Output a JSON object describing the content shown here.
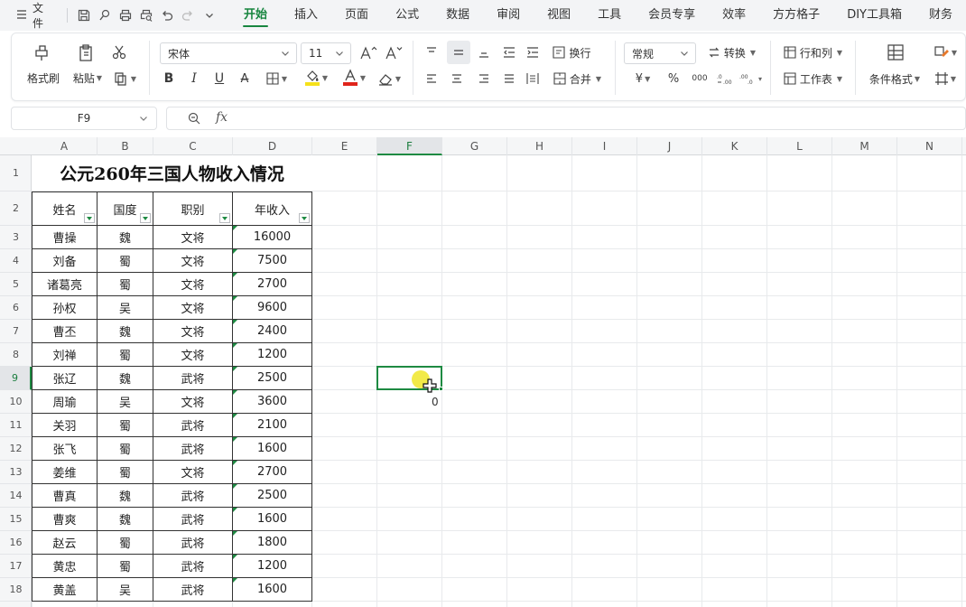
{
  "menubar": {
    "file_label": "文件",
    "tabs": [
      "开始",
      "插入",
      "页面",
      "公式",
      "数据",
      "审阅",
      "视图",
      "工具",
      "会员专享",
      "效率",
      "方方格子",
      "DIY工具箱",
      "财务"
    ],
    "active_tab": "开始"
  },
  "ribbon": {
    "format_painter": "格式刷",
    "paste": "粘贴",
    "font_name": "宋体",
    "font_size": "11",
    "bold": "B",
    "italic": "I",
    "underline": "U",
    "strike": "A",
    "wrap": "换行",
    "merge": "合并",
    "number_format": "常规",
    "convert": "转换",
    "row_col": "行和列",
    "worksheet": "工作表",
    "cond_format": "条件格式",
    "currency": "¥",
    "percent": "%",
    "thousands": "000",
    "accent_color": "#1e8a42",
    "font_color": "#e0241b",
    "fill_color": "#f5e11a"
  },
  "formula_bar": {
    "cell_ref": "F9",
    "fx_label": "fx",
    "formula": ""
  },
  "grid": {
    "columns": [
      "A",
      "B",
      "C",
      "D",
      "E",
      "F",
      "G",
      "H",
      "I",
      "J",
      "K",
      "L",
      "M",
      "N"
    ],
    "rows": [
      "1",
      "2",
      "3",
      "4",
      "5",
      "6",
      "7",
      "8",
      "9",
      "10",
      "11",
      "12",
      "13",
      "14",
      "15",
      "16",
      "17",
      "18"
    ],
    "selected_col": "F",
    "selected_row": "9"
  },
  "table": {
    "title": "公元260年三国人物收入情况",
    "headers": [
      "姓名",
      "国度",
      "职别",
      "年收入"
    ],
    "rows": [
      [
        "曹操",
        "魏",
        "文将",
        "16000"
      ],
      [
        "刘备",
        "蜀",
        "文将",
        "7500"
      ],
      [
        "诸葛亮",
        "蜀",
        "文将",
        "2700"
      ],
      [
        "孙权",
        "吴",
        "文将",
        "9600"
      ],
      [
        "曹丕",
        "魏",
        "文将",
        "2400"
      ],
      [
        "刘禅",
        "蜀",
        "文将",
        "1200"
      ],
      [
        "张辽",
        "魏",
        "武将",
        "2500"
      ],
      [
        "周瑜",
        "吴",
        "文将",
        "3600"
      ],
      [
        "关羽",
        "蜀",
        "武将",
        "2100"
      ],
      [
        "张飞",
        "蜀",
        "武将",
        "1600"
      ],
      [
        "姜维",
        "蜀",
        "文将",
        "2700"
      ],
      [
        "曹真",
        "魏",
        "武将",
        "2500"
      ],
      [
        "曹爽",
        "魏",
        "武将",
        "1600"
      ],
      [
        "赵云",
        "蜀",
        "武将",
        "1800"
      ],
      [
        "黄忠",
        "蜀",
        "武将",
        "1200"
      ],
      [
        "黄盖",
        "吴",
        "武将",
        "1600"
      ]
    ]
  },
  "drag_preview": "0"
}
